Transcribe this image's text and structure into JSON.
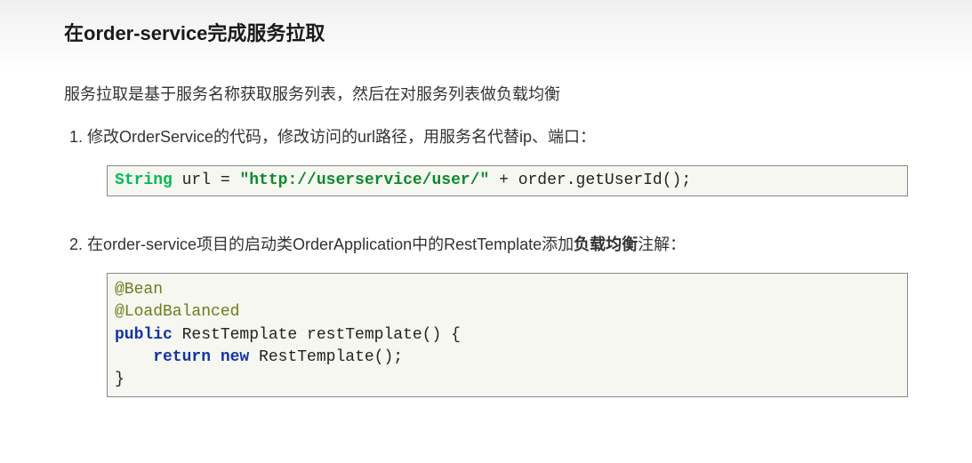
{
  "title": "在order-service完成服务拉取",
  "intro": "服务拉取是基于服务名称获取服务列表，然后在对服务列表做负载均衡",
  "steps": {
    "s1": {
      "text": "修改OrderService的代码，修改访问的url路径，用服务名代替ip、端口：",
      "code": {
        "t0": "String",
        "t1": " url = ",
        "t2": "\"http://userservice/user/\"",
        "t3": " + order.getUserId();"
      }
    },
    "s2": {
      "text_pre": "在order-service项目的启动类OrderApplication中的RestTemplate添加",
      "text_bold": "负载均衡",
      "text_post": "注解：",
      "code": {
        "l1": "@Bean",
        "l2": "@LoadBalanced",
        "l3a": "public",
        "l3b": " RestTemplate restTemplate() {",
        "l4a": "    return",
        "l4b": " new",
        "l4c": " RestTemplate();",
        "l5": "}"
      }
    }
  }
}
